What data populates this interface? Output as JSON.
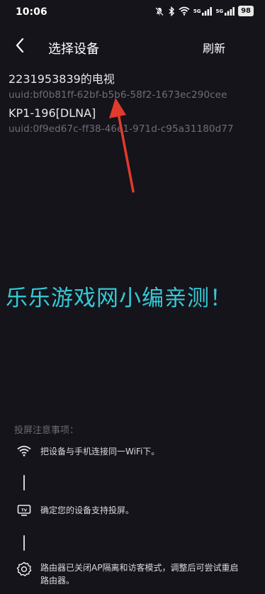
{
  "status_bar": {
    "time": "10:06",
    "battery": "98",
    "signal_label_1": "5G",
    "signal_label_2": "5G"
  },
  "header": {
    "title": "选择设备",
    "refresh_label": "刷新"
  },
  "devices": [
    {
      "name": "2231953839的电视",
      "uuid": "uuid:bf0b81ff-62bf-b5b6-58f2-1673ec290cee"
    },
    {
      "name": "KP1-196[DLNA]",
      "uuid": "uuid:0f9ed67c-ff38-46e1-971d-c95a31180d77"
    }
  ],
  "watermark": "乐乐游戏网小编亲测！",
  "tips": {
    "title": "投屏注意事项：",
    "items": [
      {
        "icon": "wifi-icon",
        "text": "把设备与手机连接同一WiFi下。"
      },
      {
        "icon": "tv-icon",
        "text": "确定您的设备支持投屏。"
      },
      {
        "icon": "gear-icon",
        "text": "路由器已关闭AP隔离和访客模式，调整后可尝试重启路由器。"
      }
    ]
  },
  "colors": {
    "background": "#15141b",
    "watermark": "#35c9d6",
    "uuid_text": "#6f6e78",
    "arrow": "#e23a2c"
  }
}
